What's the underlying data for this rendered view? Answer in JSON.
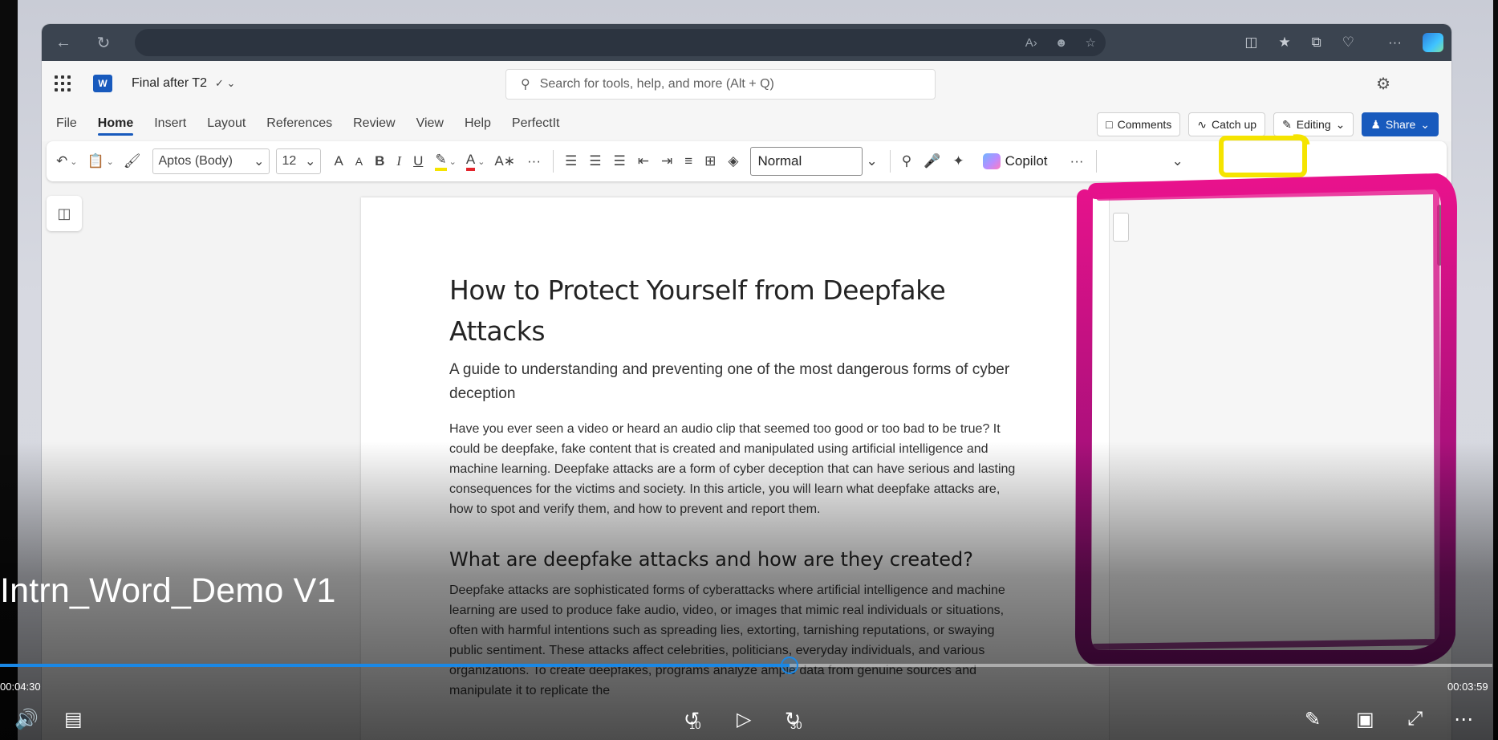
{
  "browser": {
    "icons": [
      "back-arrow-icon",
      "refresh-icon",
      "read-aloud-icon",
      "profile-icon",
      "favorite-star-icon",
      "split-screen-icon",
      "favorites-icon",
      "collections-icon",
      "heart-icon",
      "more-icon",
      "edge-copilot-icon"
    ],
    "more_label": "···"
  },
  "word": {
    "doc_name": "Final after T2",
    "search_placeholder": "Search for tools, help, and more (Alt + Q)",
    "tabs": [
      "File",
      "Home",
      "Insert",
      "Layout",
      "References",
      "Review",
      "View",
      "Help",
      "PerfectIt"
    ],
    "active_tab": "Home",
    "right_buttons": {
      "comments": "Comments",
      "catch_up": "Catch up",
      "editing": "Editing",
      "share": "Share"
    },
    "ribbon": {
      "font": "Aptos (Body)",
      "size": "12",
      "style": "Normal",
      "copilot": "Copilot",
      "glyphs": {
        "bold": "B",
        "italic": "I",
        "underline": "U",
        "grow": "A",
        "shrink": "A",
        "font_color": "A",
        "more": "···"
      }
    }
  },
  "document": {
    "title": "How to Protect Yourself from Deepfake Attacks",
    "subtitle": "A guide to understanding and preventing one of the most dangerous forms of cyber deception",
    "para1": "Have you ever seen a video or heard an audio clip that seemed too good or too bad to be true? It could be deepfake, fake content that is created and manipulated using artificial intelligence and machine learning. Deepfake attacks are a form of cyber deception that can have serious and lasting consequences for the victims and society. In this article, you will learn what deepfake attacks are, how to spot and verify them, and how to prevent and report them.",
    "heading2": "What are deepfake attacks and how are they created?",
    "para2": "Deepfake attacks are sophisticated forms of cyberattacks where artificial intelligence and machine learning are used to produce fake audio, video, or images that mimic real individuals or situations, often with harmful intentions such as spreading lies, extorting, tarnishing reputations, or swaying public sentiment. These attacks affect celebrities, politicians, everyday individuals, and various organizations. To create deepfakes, programs analyze ample data from genuine sources and manipulate it to replicate the"
  },
  "video": {
    "title": "Intrn_Word_Demo V1",
    "elapsed": "00:04:30",
    "remaining": "00:03:59",
    "progress_fraction": 0.529,
    "skip_back": "10",
    "skip_forward": "30"
  },
  "annotations": {
    "highlight_color": "#f5e400",
    "pen_color_top": "#e8128c",
    "pen_color_bottom": "#7a0f6e"
  }
}
